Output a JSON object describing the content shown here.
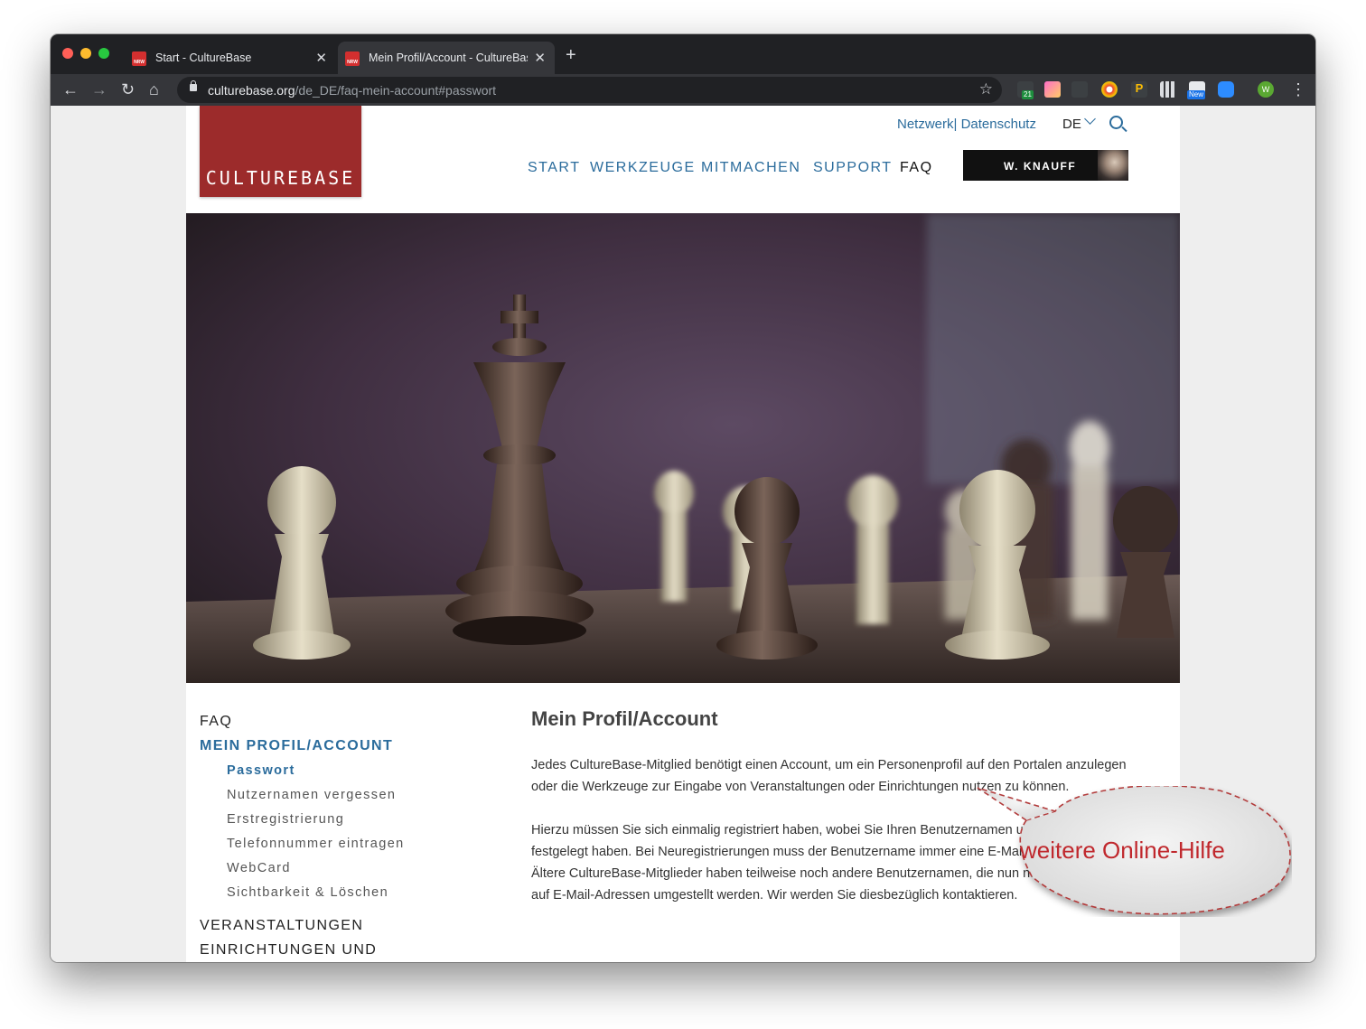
{
  "browser": {
    "tabs": [
      {
        "title": "Start - CultureBase",
        "favicon": "NRW"
      },
      {
        "title": "Mein Profil/Account - CultureBase",
        "favicon": "NRW"
      }
    ],
    "url_domain": "culturebase.org",
    "url_path": "/de_DE/faq-mein-account#passwort",
    "extension_badges": {
      "ext1": "21",
      "ext6": "New"
    },
    "profile_initial": "W"
  },
  "site": {
    "logo": "CULTUREBASE",
    "toplinks": "Netzwerk| Datenschutz",
    "language": "DE",
    "nav": [
      "START",
      "WERKZEUGE",
      "MITMACHEN",
      "SUPPORT",
      "FAQ"
    ],
    "user_button": "W. KNAUFF"
  },
  "sidebar": {
    "faq": "FAQ",
    "section": "MEIN PROFIL/ACCOUNT",
    "items": [
      "Passwort",
      "Nutzernamen vergessen",
      "Erstregistrierung",
      "Telefonnummer eintragen",
      "WebCard",
      "Sichtbarkeit & Löschen"
    ],
    "more": [
      "VERANSTALTUNGEN",
      "EINRICHTUNGEN UND"
    ]
  },
  "content": {
    "title": "Mein Profil/Account",
    "para1": "Jedes CultureBase-Mitglied benötigt einen Account, um ein Personenprofil auf den Portalen anzulegen oder die Werkzeuge zur Eingabe von Veranstaltungen oder Einrichtungen nutzen zu können.",
    "para2": "Hierzu müssen Sie sich einmalig registriert haben, wobei Sie Ihren Benutzernamen und Passwort festgelegt haben. Bei Neuregistrierungen muss der Benutzername immer eine E-Mail-Adresse sein. Ältere CultureBase-Mitglieder haben teilweise noch andere Benutzernamen, die nun nach und nach auf E-Mail-Adressen umgestellt werden. Wir werden Sie diesbezüglich kontaktieren."
  },
  "callout": {
    "text": "weitere Online-Hilfe",
    "color": "#c0282d"
  },
  "colors": {
    "brand_red": "#9c2b2b",
    "link_blue": "#2b6c9c"
  }
}
